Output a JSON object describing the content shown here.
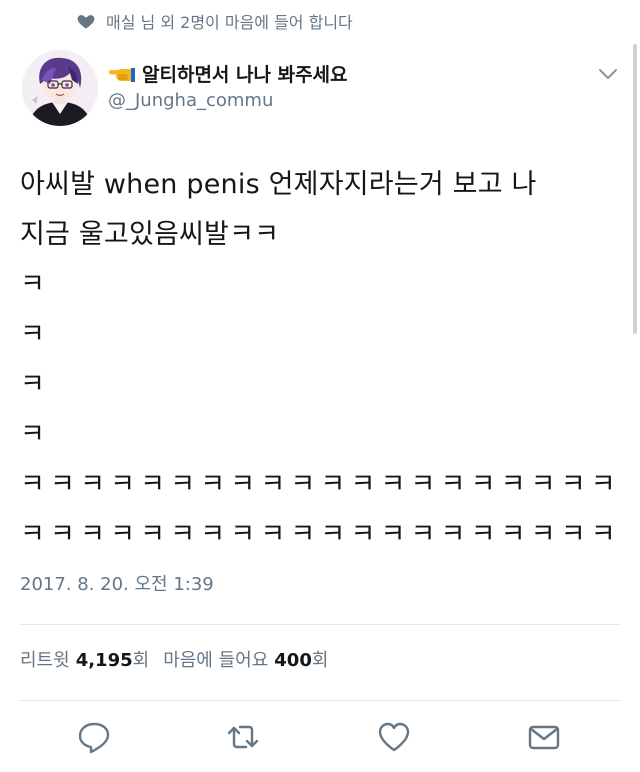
{
  "social_context": {
    "text": "매실 님 외 2명이 마음에 들어 합니다",
    "icon": "heart-icon"
  },
  "author": {
    "display_name": "알티하면서 나나 봐주세요",
    "name_icon": "backhand-index-pointing-left-emoji",
    "handle": "@_Jungha_commu"
  },
  "tweet": {
    "lines": [
      "아씨발 when penis 언제자지라는거 보고 나",
      "지금 울고있음씨발ㅋㅋ",
      "ㅋ",
      "ㅋ",
      "ㅋ",
      "ㅋ",
      "ㅋㅋㅋㅋㅋㅋㅋㅋㅋㅋㅋㅋㅋㅋㅋㅋㅋㅋㅋㅋ",
      "ㅋㅋㅋㅋㅋㅋㅋㅋㅋㅋㅋㅋㅋㅋㅋㅋㅋㅋㅋㅋ"
    ],
    "timestamp": "2017. 8. 20. 오전 1:39"
  },
  "stats": {
    "retweets_label": "리트윗",
    "retweets_count": "4,195",
    "retweets_unit": "회",
    "likes_label": "마음에 들어요",
    "likes_count": "400",
    "likes_unit": "회"
  },
  "actions": [
    "reply-icon",
    "retweet-icon",
    "like-icon",
    "share-icon"
  ],
  "colors": {
    "text": "#14171a",
    "secondary": "#657786",
    "divider": "#e1e8ed"
  }
}
